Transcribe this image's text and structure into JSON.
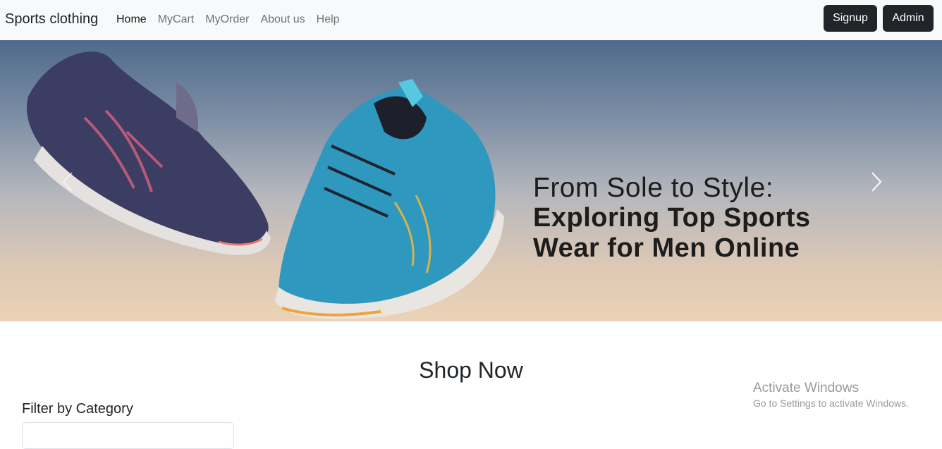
{
  "navbar": {
    "brand": "Sports clothing",
    "links": [
      {
        "label": "Home",
        "active": true
      },
      {
        "label": "MyCart",
        "active": false
      },
      {
        "label": "MyOrder",
        "active": false
      },
      {
        "label": "About us",
        "active": false
      },
      {
        "label": "Help",
        "active": false
      }
    ],
    "signup_label": "Signup",
    "admin_label": "Admin"
  },
  "carousel": {
    "headline_line1": "From Sole to Style:",
    "headline_line2": "Exploring Top Sports",
    "headline_line3": "Wear for Men Online",
    "prev_icon": "chevron-left-icon",
    "next_icon": "chevron-right-icon"
  },
  "main": {
    "section_title": "Shop Now",
    "filter_label": "Filter by Category"
  },
  "watermark": {
    "title": "Activate Windows",
    "subtitle": "Go to Settings to activate Windows."
  },
  "colors": {
    "navbar_bg": "#f8f9fa",
    "button_dark": "#212529",
    "link_muted": "#6c757d"
  }
}
